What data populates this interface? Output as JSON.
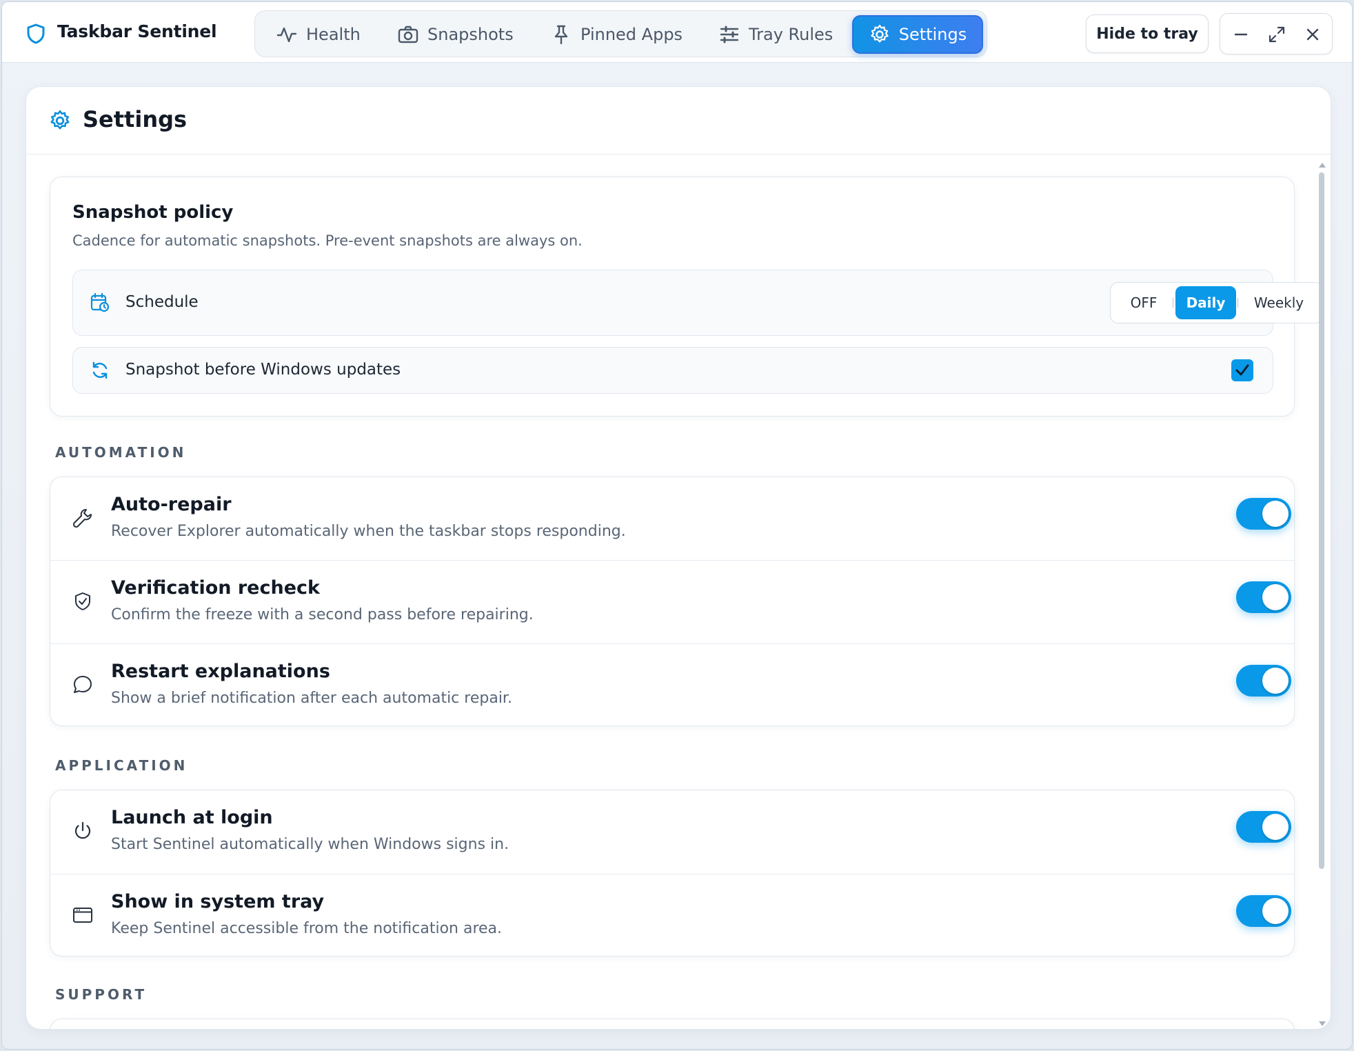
{
  "app": {
    "title": "Taskbar Sentinel",
    "accent": "#0a99e8"
  },
  "tabs": [
    {
      "label": "Health",
      "icon": "activity-icon",
      "active": false
    },
    {
      "label": "Snapshots",
      "icon": "camera-icon",
      "active": false
    },
    {
      "label": "Pinned Apps",
      "icon": "pin-icon",
      "active": false
    },
    {
      "label": "Tray Rules",
      "icon": "sliders-icon",
      "active": false
    },
    {
      "label": "Settings",
      "icon": "gear-icon",
      "active": true
    }
  ],
  "titlebar": {
    "hide_label": "Hide to tray"
  },
  "page": {
    "title": "Settings"
  },
  "snapshot_policy": {
    "title": "Snapshot policy",
    "description": "Cadence for automatic snapshots. Pre-event snapshots are always on.",
    "schedule": {
      "label": "Schedule",
      "options": [
        "OFF",
        "Daily",
        "Weekly"
      ],
      "selected": "Daily"
    },
    "before_updates": {
      "label": "Snapshot before Windows updates",
      "checked": true
    }
  },
  "sections": {
    "automation": "AUTOMATION",
    "application": "APPLICATION",
    "support": "SUPPORT"
  },
  "automation": [
    {
      "title": "Auto-repair",
      "desc": "Recover Explorer automatically when the taskbar stops responding.",
      "icon": "wrench-icon",
      "on": true
    },
    {
      "title": "Verification recheck",
      "desc": "Confirm the freeze with a second pass before repairing.",
      "icon": "shield-check-icon",
      "on": true
    },
    {
      "title": "Restart explanations",
      "desc": "Show a brief notification after each automatic repair.",
      "icon": "chat-bubble-icon",
      "on": true
    }
  ],
  "application": [
    {
      "title": "Launch at login",
      "desc": "Start Sentinel automatically when Windows signs in.",
      "icon": "power-icon",
      "on": true
    },
    {
      "title": "Show in system tray",
      "desc": "Keep Sentinel accessible from the notification area.",
      "icon": "window-icon",
      "on": true
    }
  ]
}
